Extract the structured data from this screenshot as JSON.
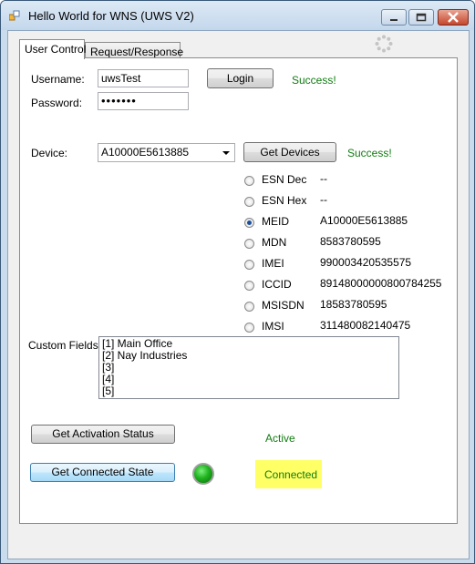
{
  "window": {
    "title": "Hello World for WNS (UWS V2)",
    "icons": {
      "app": "app-icon",
      "minimize": "minimize-icon",
      "maximize": "maximize-icon",
      "close": "close-icon",
      "spinner": "loading-spinner-icon"
    }
  },
  "tabs": [
    {
      "label": "User Control",
      "active": true
    },
    {
      "label": "Request/Response",
      "active": false
    }
  ],
  "login": {
    "username_label": "Username:",
    "username_value": "uwsTest",
    "password_label": "Password:",
    "password_value": "•••••••",
    "login_button": "Login",
    "login_status": "Success!"
  },
  "device": {
    "device_label": "Device:",
    "device_selected": "A10000E5613885",
    "get_devices_button": "Get Devices",
    "get_devices_status": "Success!",
    "identifiers": [
      {
        "label": "ESN Dec",
        "value": "--",
        "checked": false
      },
      {
        "label": "ESN Hex",
        "value": "--",
        "checked": false
      },
      {
        "label": "MEID",
        "value": "A10000E5613885",
        "checked": true
      },
      {
        "label": "MDN",
        "value": "8583780595",
        "checked": false
      },
      {
        "label": "IMEI",
        "value": "990003420535575",
        "checked": false
      },
      {
        "label": "ICCID",
        "value": "89148000000800784255",
        "checked": false
      },
      {
        "label": "MSISDN",
        "value": "18583780595",
        "checked": false
      },
      {
        "label": "IMSI",
        "value": "311480082140475",
        "checked": false
      }
    ]
  },
  "custom_fields": {
    "label": "Custom Fields:",
    "items": [
      "[1] Main Office",
      "[2] Nay Industries",
      "[3]",
      "[4]",
      "[5]"
    ]
  },
  "status": {
    "activation_button": "Get Activation Status",
    "activation_value": "Active",
    "connected_button": "Get Connected State",
    "connected_value": "Connected",
    "led_color": "#1fb31f",
    "highlight_color": "#ffff66"
  }
}
